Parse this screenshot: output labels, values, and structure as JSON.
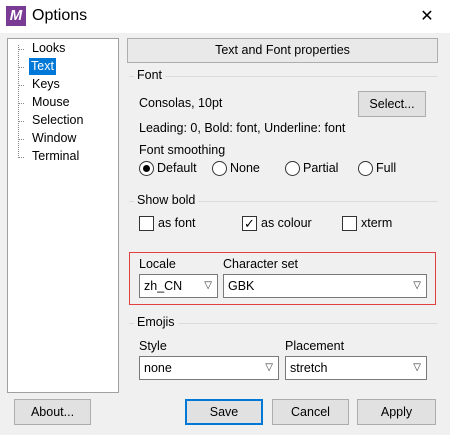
{
  "window": {
    "title": "Options",
    "app_icon_letter": "M",
    "close_glyph": "✕"
  },
  "tree": {
    "items": [
      "Looks",
      "Text",
      "Keys",
      "Mouse",
      "Selection",
      "Window",
      "Terminal"
    ],
    "selected_index": 1
  },
  "panel": {
    "title": "Text and Font properties"
  },
  "font": {
    "group_label": "Font",
    "font_name": "Consolas, 10pt",
    "select_label": "Select...",
    "info": "Leading: 0, Bold: font, Underline: font",
    "smoothing_label": "Font smoothing",
    "smoothing_options": [
      "Default",
      "None",
      "Partial",
      "Full"
    ],
    "smoothing_selected": "Default"
  },
  "show_bold": {
    "group_label": "Show bold",
    "options": [
      {
        "label": "as font",
        "checked": false
      },
      {
        "label": "as colour",
        "checked": true
      },
      {
        "label": "xterm",
        "checked": false
      }
    ]
  },
  "locale": {
    "locale_label": "Locale",
    "locale_value": "zh_CN",
    "charset_label": "Character set",
    "charset_value": "GBK"
  },
  "emojis": {
    "group_label": "Emojis",
    "style_label": "Style",
    "style_value": "none",
    "placement_label": "Placement",
    "placement_value": "stretch"
  },
  "buttons": {
    "about": "About...",
    "save": "Save",
    "cancel": "Cancel",
    "apply": "Apply"
  },
  "icons": {
    "dropdown": "chevron-down-icon",
    "check": "✓"
  },
  "colors": {
    "accent": "#0078d7",
    "app_icon": "#7a3b94",
    "highlight_border": "#e04040"
  }
}
